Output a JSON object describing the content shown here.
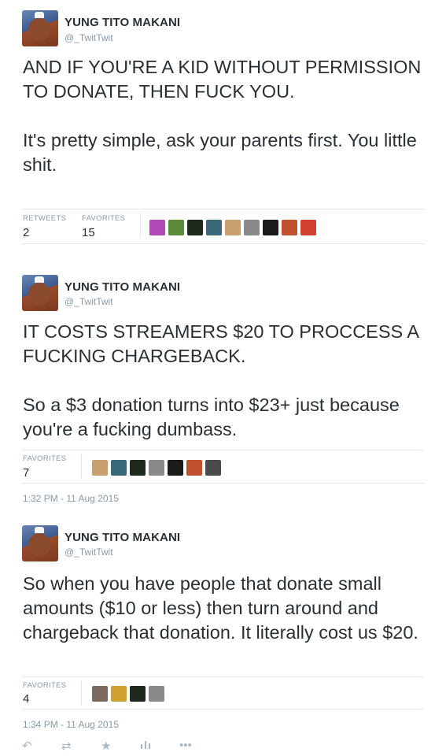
{
  "tweets": [
    {
      "name": "YUNG TITO MAKANI",
      "handle": "@_TwitTwit",
      "text": "AND IF YOU'RE A KID WITHOUT PERMISSION TO DONATE, THEN FUCK YOU.\n\nIt's pretty simple, ask your parents first. You little shit.",
      "retweets_label": "RETWEETS",
      "retweets": "2",
      "favorites_label": "FAVORITES",
      "favorites": "15",
      "favoriters": [
        "#b04ab8",
        "#5a8a3a",
        "#1e2a1e",
        "#3a6a7a",
        "#c8a070",
        "#8a8a8a",
        "#1a1a1a",
        "#c05030",
        "#d04030"
      ]
    },
    {
      "name": "YUNG TITO MAKANI",
      "handle": "@_TwitTwit",
      "text": "IT COSTS STREAMERS $20 TO PROCCESS A FUCKING CHARGEBACK.\n\nSo a $3 donation turns into $23+ just because you're a fucking dumbass.",
      "favorites_label": "FAVORITES",
      "favorites": "7",
      "favoriters": [
        "#c8a070",
        "#3a6a7a",
        "#1e2a1e",
        "#8a8a8a",
        "#1a1a1a",
        "#c05030",
        "#4a4a4a"
      ],
      "timestamp": "1:32 PM - 11 Aug 2015"
    },
    {
      "name": "YUNG TITO MAKANI",
      "handle": "@_TwitTwit",
      "text": "So when you have people that donate small amounts ($10 or less) then turn around and chargeback that donation. It literally cost us $20.",
      "favorites_label": "FAVORITES",
      "favorites": "4",
      "favoriters": [
        "#7a6a60",
        "#d0a030",
        "#1e2a1e",
        "#8a8a8a"
      ],
      "timestamp": "1:34 PM - 11 Aug 2015"
    }
  ],
  "actions": {
    "reply_icon": "reply-icon",
    "retweet_icon": "retweet-icon",
    "favorite_icon": "star-icon",
    "stats_icon": "bar-chart-icon",
    "more_icon": "more-dots-icon"
  }
}
